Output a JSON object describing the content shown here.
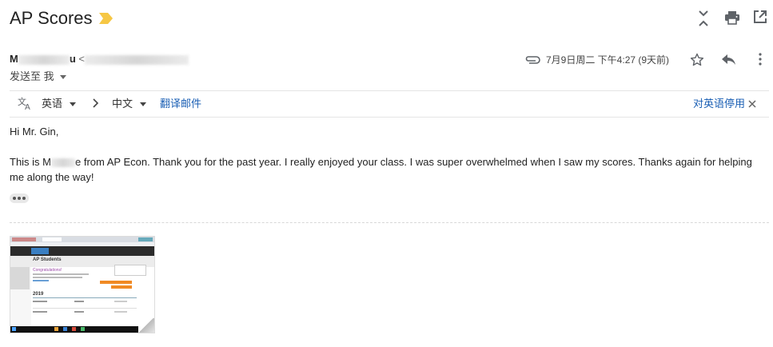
{
  "email": {
    "subject": "AP Scores",
    "sender_prefix": "M",
    "sender_suffix": "u",
    "sender_bracket": "<",
    "send_to_label": "发送至 我",
    "date": "7月9日周二 下午4:27 (9天前)"
  },
  "translate_bar": {
    "source_language": "英语",
    "target_language": "中文",
    "translate_label": "翻译邮件",
    "disable_label": "对英语停用"
  },
  "body": {
    "greeting": "Hi Mr. Gin,",
    "line_start": "This is M",
    "line_rest": "e from AP Econ. Thank you for the past year. I really enjoyed your class. I was super overwhelmed when I saw my scores. Thanks again for helping me along the way!"
  },
  "attachment": {
    "header_title": "AP Students",
    "congrats": "Congratulations!",
    "year": "2019"
  },
  "colors": {
    "tag_yellow": "#f6c744",
    "link_blue": "#1a5fb4",
    "icon_gray": "#5f6368"
  }
}
